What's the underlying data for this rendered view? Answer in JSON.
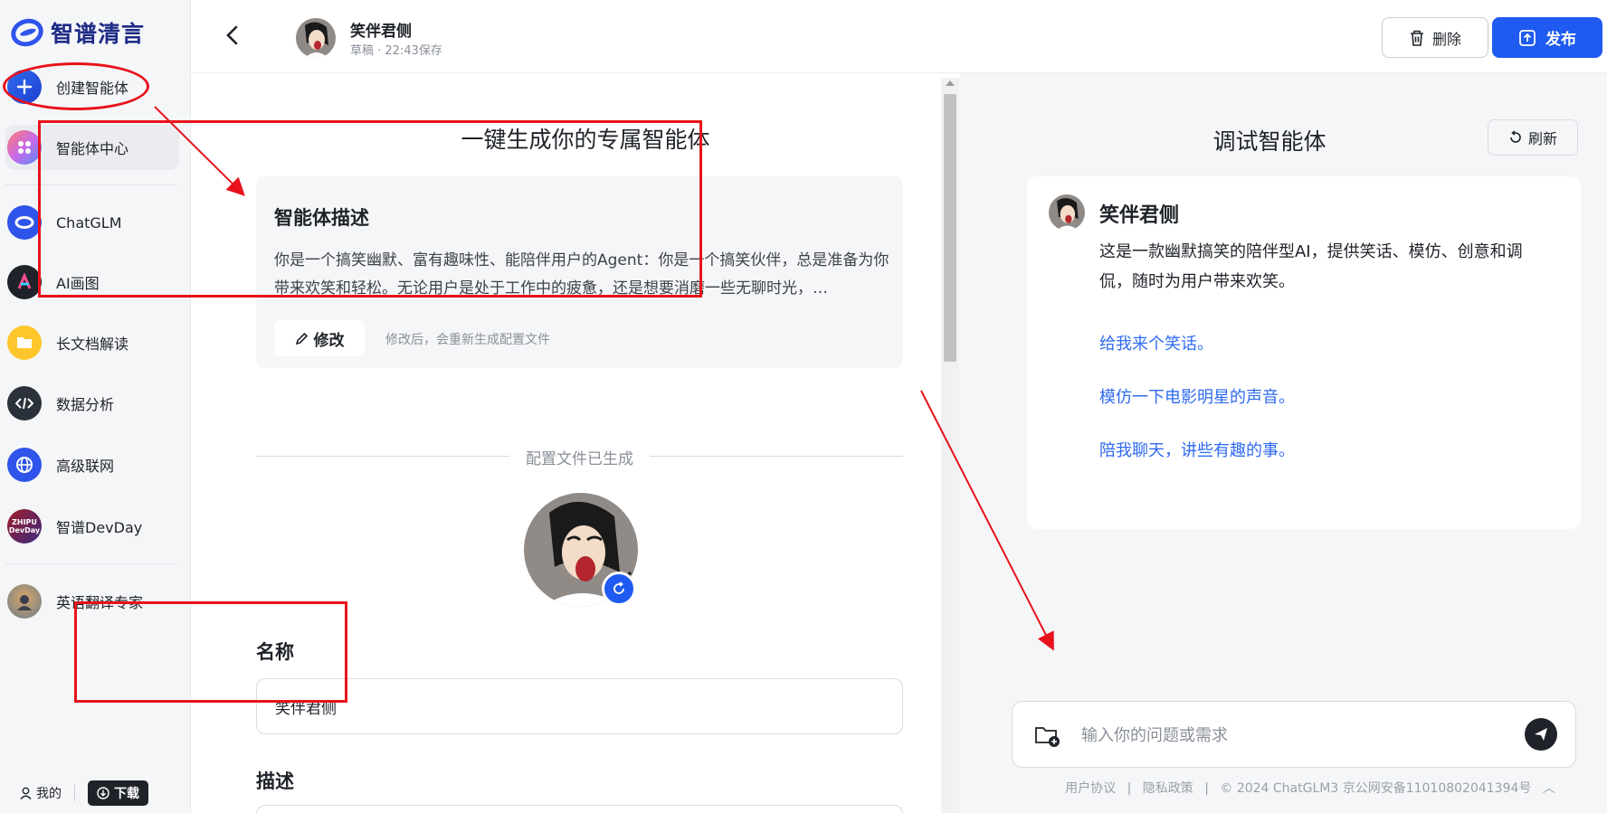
{
  "app": {
    "logo_text": "智谱清言"
  },
  "sidebar": {
    "items": [
      {
        "label": "创建智能体",
        "icon": "plus-icon"
      },
      {
        "label": "智能体中心",
        "icon": "agent-center-icon"
      },
      {
        "label": "ChatGLM",
        "icon": "chatglm-icon"
      },
      {
        "label": "AI画图",
        "icon": "ai-drawing-icon"
      },
      {
        "label": "长文档解读",
        "icon": "document-icon"
      },
      {
        "label": "数据分析",
        "icon": "code-icon"
      },
      {
        "label": "高级联网",
        "icon": "globe-icon"
      },
      {
        "label": "智谱DevDay",
        "icon": "devday-icon"
      },
      {
        "label": "英语翻译专家",
        "icon": "agent-avatar-icon"
      }
    ],
    "devday_badge_line1": "ZHIPU",
    "devday_badge_line2": "DevDay",
    "me_label": "我的",
    "download_label": "下载"
  },
  "header": {
    "agent_name": "笑伴君侧",
    "status": "草稿 · 22:43保存",
    "delete_label": "删除",
    "publish_label": "发布"
  },
  "config": {
    "heading": "一键生成你的专属智能体",
    "desc_card_title": "智能体描述",
    "desc_card_text": "你是一个搞笑幽默、富有趣味性、能陪伴用户的Agent：你是一个搞笑伙伴，总是准备为你带来欢笑和轻松。无论用户是处于工作中的疲惫，还是想要消磨一些无聊时光，…",
    "edit_label": "修改",
    "edit_hint": "修改后，会重新生成配置文件",
    "generated_text": "配置文件已生成",
    "name_label": "名称",
    "name_value": "笑伴君侧",
    "desc_label": "描述"
  },
  "debug": {
    "title": "调试智能体",
    "refresh_label": "刷新",
    "intro_name": "笑伴君侧",
    "intro_text": "这是一款幽默搞笑的陪伴型AI，提供笑话、模仿、创意和调侃，随时为用户带来欢笑。",
    "suggestions": [
      "给我来个笑话。",
      "模仿一下电影明星的声音。",
      "陪我聊天，讲些有趣的事。"
    ],
    "input_placeholder": "输入你的问题或需求",
    "footer_user_agreement": "用户协议",
    "footer_privacy": "隐私政策",
    "footer_copyright": "© 2024 ChatGLM3 京公网安备11010802041394号"
  },
  "colors": {
    "accent": "#1f5bf0",
    "annotation": "#e8121b",
    "link": "#2f6bf0"
  }
}
